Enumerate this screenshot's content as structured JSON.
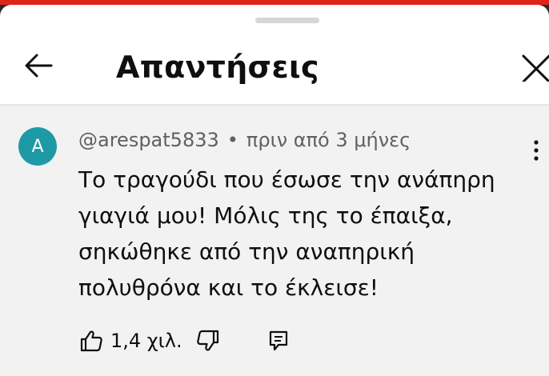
{
  "header": {
    "title": "Απαντήσεις",
    "back_icon": "arrow-left-icon",
    "close_icon": "close-icon"
  },
  "comment": {
    "avatar_letter": "A",
    "avatar_color": "#1e9aa6",
    "author": "@arespat5833",
    "separator": "•",
    "time": "πριν από 3 μήνες",
    "text": "Το τραγούδι που έσωσε την ανάπηρη γιαγιά μου! Μόλις της το έπαιξα, σηκώθηκε από την αναπηρική πολυθρόνα και το έκλεισε!",
    "likes": "1,4 χιλ.",
    "icons": {
      "more": "more-vertical-icon",
      "like": "thumbs-up-icon",
      "dislike": "thumbs-down-icon",
      "reply": "reply-comment-icon"
    }
  }
}
